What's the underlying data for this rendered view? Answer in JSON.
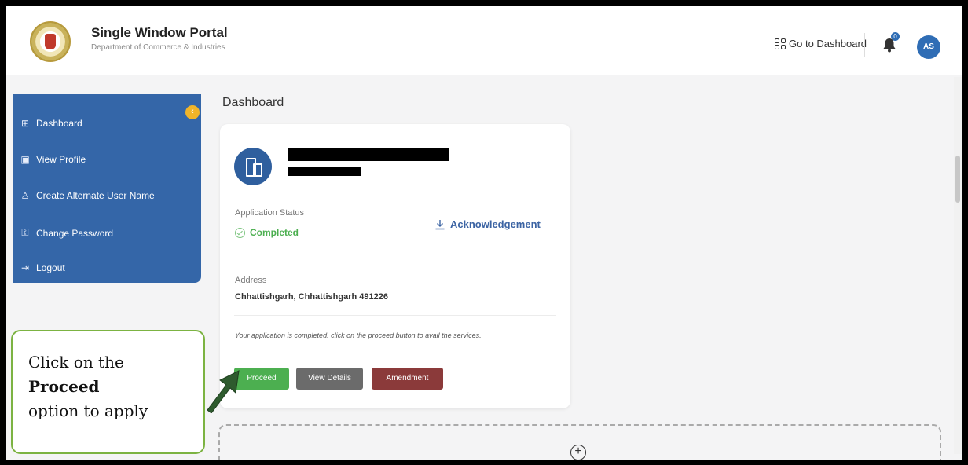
{
  "header": {
    "title": "Single Window Portal",
    "subtitle": "Department of Commerce & Industries",
    "goto_dashboard": "Go to Dashboard",
    "notification_count": "0",
    "avatar_initials": "AS"
  },
  "sidebar": {
    "items": [
      {
        "label": "Dashboard",
        "icon": "grid-icon"
      },
      {
        "label": "View Profile",
        "icon": "profile-icon"
      },
      {
        "label": "Create Alternate User Name",
        "icon": "user-add-icon"
      },
      {
        "label": "Change Password",
        "icon": "lock-icon"
      },
      {
        "label": "Logout",
        "icon": "logout-icon"
      }
    ]
  },
  "main": {
    "page_title": "Dashboard",
    "card": {
      "status_label": "Application Status",
      "status_value": "Completed",
      "acknowledgement": "Acknowledgement",
      "address_label": "Address",
      "address_value": "Chhattishgarh, Chhattishgarh 491226",
      "note": "Your application is completed. click on the proceed button to avail the services.",
      "buttons": {
        "proceed": "Proceed",
        "view_details": "View Details",
        "amendment": "Amendment"
      }
    }
  },
  "callout": {
    "line1": "Click on the",
    "line2": "Proceed",
    "line3": "option to apply"
  },
  "colors": {
    "sidebar": "#3466a8",
    "proceed": "#4caf50",
    "view_details": "#6b6b6b",
    "amendment": "#8b3a3a",
    "accent": "#2f6db5"
  }
}
